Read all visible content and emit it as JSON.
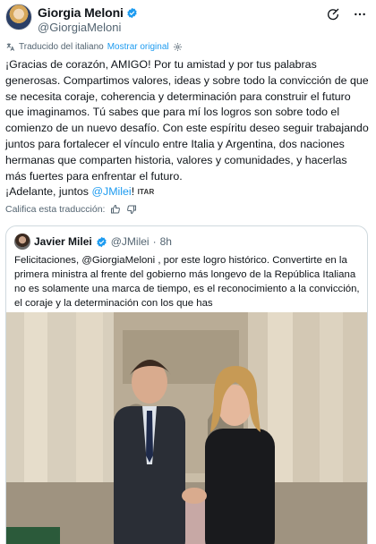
{
  "tweet": {
    "author_name": "Giorgia Meloni",
    "author_handle": "@GiorgiaMeloni",
    "translated_label": "Traducido del italiano",
    "show_original": "Mostrar original",
    "text": "¡Gracias de corazón, AMIGO! Por tu amistad y por tus palabras generosas. Compartimos valores, ideas y sobre todo la convicción de que se necesita coraje, coherencia y determinación para construir el futuro que imaginamos. Tú sabes que para mí los logros son sobre todo el comienzo de un nuevo desafío. Con este espíritu deseo seguir trabajando juntos para fortalecer el vínculo entre Italia y Argentina, dos naciones hermanas que comparten historia, valores y comunidades, y hacerlas más fuertes para enfrentar el futuro.",
    "closing": "¡Adelante, juntos ",
    "mention": "@JMilei",
    "closing_end": "!",
    "flag": "ITAR",
    "rate_translation": "Califica esta traducción:"
  },
  "quote": {
    "author_name": "Javier Milei",
    "author_handle": "@JMilei",
    "time": "8h",
    "text": "Felicitaciones, @GiorgiaMeloni , por este logro histórico. Convertirte en la primera ministra al frente del gobierno más longevo de la República Italiana no es solamente una marca de tiempo, es el reconocimiento a la convicción, el coraje y la determinación con los que has"
  },
  "icons": {
    "verified": "verified-badge-icon",
    "grok": "grok-icon",
    "more": "more-icon",
    "translate": "translate-icon",
    "settings": "gear-icon",
    "thumbs_up": "thumbs-up-icon",
    "thumbs_down": "thumbs-down-icon"
  },
  "colors": {
    "accent": "#1d9bf0",
    "muted": "#536471",
    "verified": "#1d9bf0"
  }
}
